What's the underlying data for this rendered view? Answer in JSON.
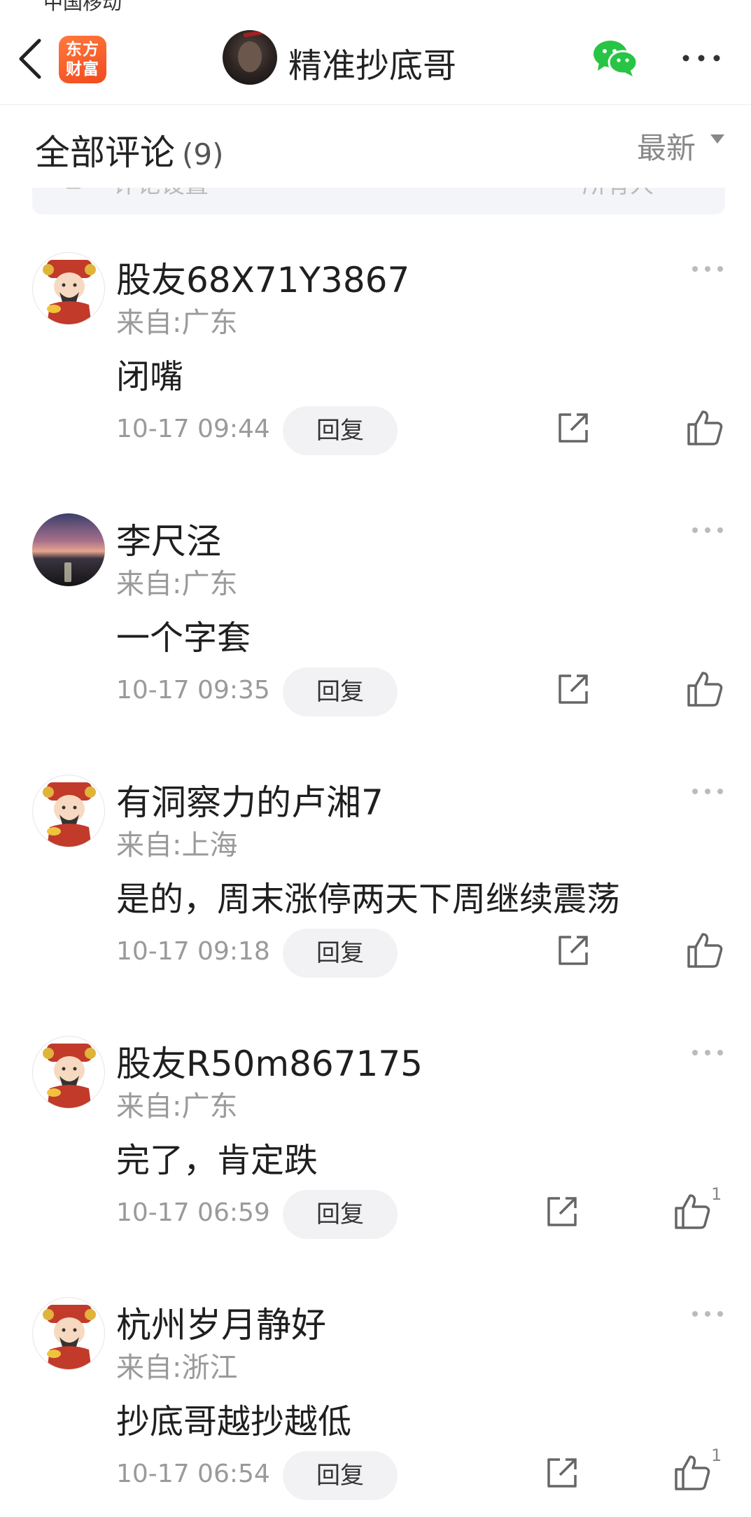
{
  "status_bar": {
    "carrier": "中国移动"
  },
  "header": {
    "app_logo_text": [
      "东方",
      "财富"
    ],
    "author_name": "精准抄底哥"
  },
  "comments_section": {
    "title": "全部评论",
    "count": "(9)",
    "sort_label": "最新",
    "settings_ghost_left": "评论设置",
    "settings_ghost_right": "所有人"
  },
  "comments": [
    {
      "user": "股友68X71Y3867",
      "loc_label": "来自:",
      "location": "广东",
      "text": "闭嘴",
      "time": "10-17 09:44",
      "reply": "回复",
      "likes": "",
      "avatar": "god-of-wealth-avatar"
    },
    {
      "user": "李尺泾",
      "loc_label": "来自:",
      "location": "广东",
      "text": "一个字套",
      "time": "10-17 09:35",
      "reply": "回复",
      "likes": "",
      "avatar": "sunset-photo-avatar"
    },
    {
      "user": "有洞察力的卢湘7",
      "loc_label": "来自:",
      "location": "上海",
      "text": "是的，周末涨停两天下周继续震荡",
      "time": "10-17 09:18",
      "reply": "回复",
      "likes": "",
      "avatar": "god-of-wealth-avatar"
    },
    {
      "user": "股友R50m867175",
      "loc_label": "来自:",
      "location": "广东",
      "text": "完了，肯定跌",
      "time": "10-17 06:59",
      "reply": "回复",
      "likes": "1",
      "avatar": "god-of-wealth-avatar"
    },
    {
      "user": "杭州岁月静好",
      "loc_label": "来自:",
      "location": "浙江",
      "text": "抄底哥越抄越低",
      "time": "10-17 06:54",
      "reply": "回复",
      "likes": "1",
      "avatar": "god-of-wealth-avatar"
    }
  ],
  "colors": {
    "brand": "#f14a1e",
    "wechat": "#28c445",
    "muted": "#9a9a9a"
  }
}
